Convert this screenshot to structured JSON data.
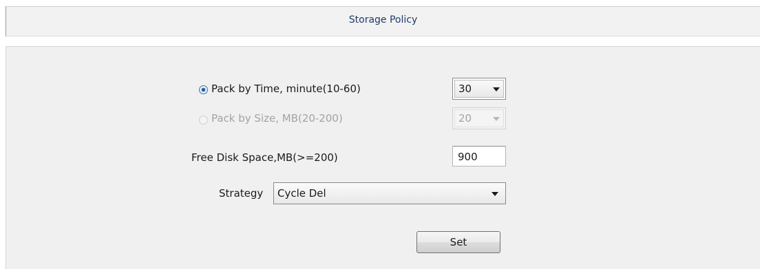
{
  "header": {
    "title": "Storage Policy"
  },
  "pack_by_time": {
    "label": "Pack by Time, minute(10-60)",
    "selected": true,
    "value": "30"
  },
  "pack_by_size": {
    "label": "Pack by Size, MB(20-200)",
    "selected": false,
    "enabled": false,
    "value": "20"
  },
  "free_disk_space": {
    "label": "Free Disk Space,MB(>=200)",
    "value": "900"
  },
  "strategy": {
    "label": "Strategy",
    "value": "Cycle Del"
  },
  "actions": {
    "set_label": "Set"
  },
  "colors": {
    "title_text": "#1f3a6b",
    "panel_background": "#f0f0f0",
    "header_background": "#f2f2f2"
  }
}
